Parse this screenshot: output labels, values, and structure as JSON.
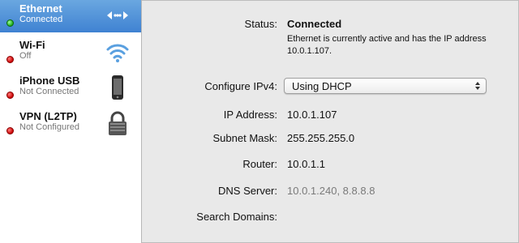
{
  "services": [
    {
      "name": "Ethernet",
      "status": "Connected",
      "selected": true,
      "icon": "ethernet-arrows-icon"
    },
    {
      "name": "Wi-Fi",
      "status": "Off",
      "selected": false,
      "icon": "wifi-icon"
    },
    {
      "name": "iPhone USB",
      "status": "Not Connected",
      "selected": false,
      "icon": "iphone-icon"
    },
    {
      "name": "VPN (L2TP)",
      "status": "Not Configured",
      "selected": false,
      "icon": "lock-icon"
    }
  ],
  "detail": {
    "status_label": "Status:",
    "status_value": "Connected",
    "status_description": "Ethernet is currently active and has the IP address 10.0.1.107.",
    "configure_label": "Configure IPv4:",
    "configure_value": "Using DHCP",
    "ip_label": "IP Address:",
    "ip_value": "10.0.1.107",
    "subnet_label": "Subnet Mask:",
    "subnet_value": "255.255.255.0",
    "router_label": "Router:",
    "router_value": "10.0.1.1",
    "dns_label": "DNS Server:",
    "dns_value": "10.0.1.240, 8.8.8.8",
    "search_label": "Search Domains:",
    "search_value": ""
  },
  "colors": {
    "selection": "#3f82d2",
    "status_connected": "#1ea81e",
    "status_off": "#c90000",
    "wifi": "#5aa0e0"
  }
}
